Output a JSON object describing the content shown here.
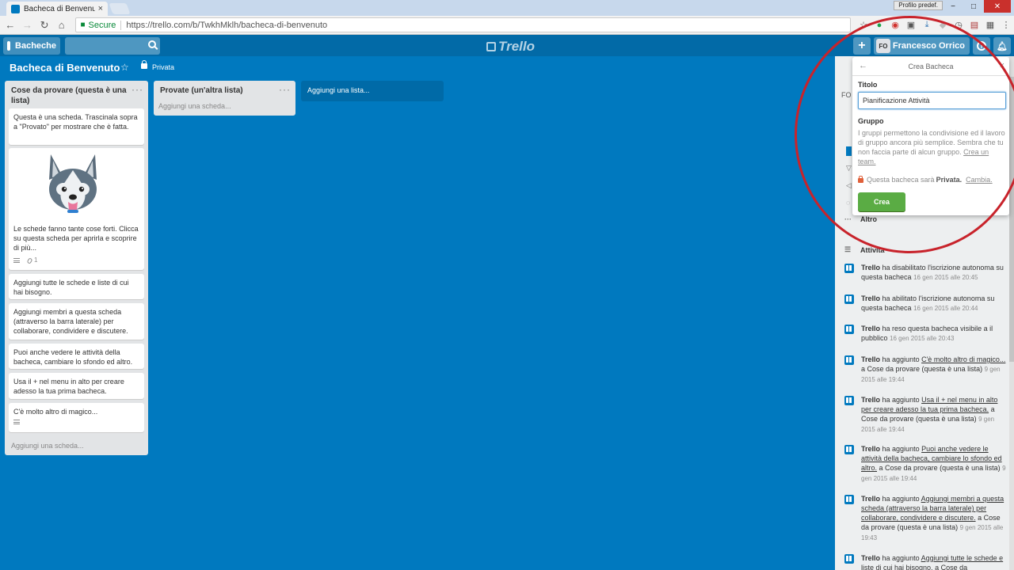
{
  "browser": {
    "tab_title": "Bacheca di Benvenuto | T",
    "tab_close": "×",
    "window_user": "Profilo predef.",
    "secure_label": "Secure",
    "url": "https://trello.com/b/TwkhMklh/bacheca-di-benvenuto"
  },
  "header": {
    "boards_label": "Bacheche",
    "logo": "Trello",
    "add_label": "+",
    "avatar_initials": "FO",
    "member_name": "Francesco Orrico",
    "info_label": "i"
  },
  "board": {
    "title": "Bacheca di Benvenuto",
    "privacy": "Privata",
    "add_list": "Aggiungi una lista..."
  },
  "lists": [
    {
      "title": "Cose da provare (questa è una lista)",
      "menu": "···",
      "add_card": "Aggiungi una scheda...",
      "cards": [
        "Questa è una scheda. Trascinala sopra a \"Provato\" per mostrare che è fatta.",
        "Le schede fanno tante cose forti. Clicca su questa scheda per aprirla e scoprire di più...",
        "Aggiungi tutte le schede e liste di cui hai bisogno.",
        "Aggiungi membri a questa scheda (attraverso la barra laterale) per collaborare, condividere e discutere.",
        "Puoi anche vedere le attività della bacheca, cambiare lo sfondo ed altro.",
        "Usa il + nel menu in alto per creare adesso la tua prima bacheca.",
        "C'è molto altro di magico..."
      ],
      "attachment_count": "1"
    },
    {
      "title": "Provate (un'altra lista)",
      "menu": "···",
      "add_card": "Aggiungi una scheda..."
    }
  ],
  "sidebar": {
    "partial_fo": "FO",
    "more_label": "Altro",
    "activity_label": "Attività",
    "activities": [
      {
        "user": "Trello",
        "pre": "ha disabilitato l'iscrizione autonoma su questa bacheca",
        "link": "",
        "post": "",
        "date": "16 gen 2015 alle 20:45"
      },
      {
        "user": "Trello",
        "pre": "ha abilitato l'iscrizione autonoma su questa bacheca",
        "link": "",
        "post": "",
        "date": "16 gen 2015 alle 20:44"
      },
      {
        "user": "Trello",
        "pre": "ha reso questa bacheca visibile a il pubblico",
        "link": "",
        "post": "",
        "date": "16 gen 2015 alle 20:43"
      },
      {
        "user": "Trello",
        "pre": "ha aggiunto",
        "link": "C'è molto altro di magico...",
        "post": "a Cose da provare (questa è una lista)",
        "date": "9 gen 2015 alle 19:44"
      },
      {
        "user": "Trello",
        "pre": "ha aggiunto",
        "link": "Usa il + nel menu in alto per creare adesso la tua prima bacheca.",
        "post": "a Cose da provare (questa è una lista)",
        "date": "9 gen 2015 alle 19:44"
      },
      {
        "user": "Trello",
        "pre": "ha aggiunto",
        "link": "Puoi anche vedere le attività della bacheca, cambiare lo sfondo ed altro.",
        "post": "a Cose da provare (questa è una lista)",
        "date": "9 gen 2015 alle 19:44"
      },
      {
        "user": "Trello",
        "pre": "ha aggiunto",
        "link": "Aggiungi membri a questa scheda (attraverso la barra laterale) per collaborare, condividere e discutere.",
        "post": "a Cose da provare (questa è una lista)",
        "date": "9 gen 2015 alle 19:43"
      },
      {
        "user": "Trello",
        "pre": "ha aggiunto",
        "link": "Aggiungi tutte le schede e liste di cui hai bisogno.",
        "post": "a Cose da",
        "date": ""
      }
    ]
  },
  "popover": {
    "title": "Crea Bacheca",
    "back": "←",
    "close": "×",
    "title_label": "Titolo",
    "title_value": "Pianificazione Attività",
    "group_label": "Gruppo",
    "group_text": "I gruppi permettono la condivisione ed il lavoro di gruppo ancora più semplice. Sembra che tu non faccia parte di alcun gruppo.",
    "group_link": "Crea un team.",
    "private_pre": "Questa bacheca sarà",
    "private_bold": "Privata.",
    "private_link": "Cambia.",
    "create_label": "Crea"
  },
  "colors": {
    "board_bg": "#0079bf",
    "header_bg": "#026aa7",
    "create_button": "#5aac44",
    "annotation": "#c8232b"
  }
}
